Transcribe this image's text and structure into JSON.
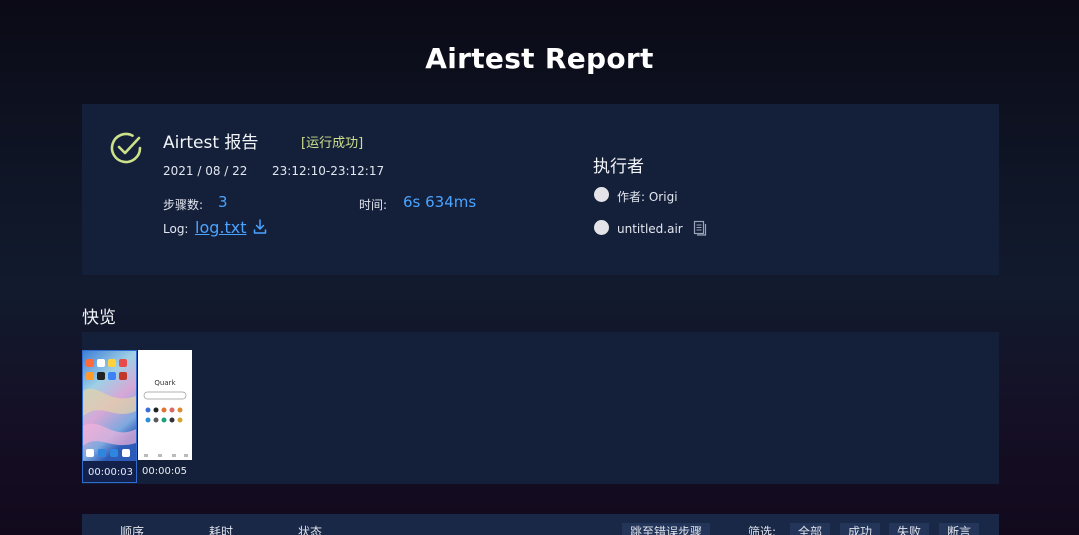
{
  "page_title": "Airtest Report",
  "summary": {
    "report_name": "Airtest 报告",
    "status": "[运行成功]",
    "date": "2021 / 08 / 22",
    "time_range": "23:12:10-23:12:17",
    "steps_label": "步骤数:",
    "steps_value": "3",
    "duration_label": "时间:",
    "duration_value": "6s 634ms",
    "log_label": "Log:",
    "log_file": "log.txt",
    "status_color": "#cde08a",
    "accent_color": "#4aa3ff"
  },
  "executor": {
    "title": "执行者",
    "author": "作者:  Origi",
    "script": "untitled.air"
  },
  "gallery": {
    "title": "快览",
    "thumbnails": [
      {
        "time": "00:00:03",
        "app": "home-screen"
      },
      {
        "time": "00:00:05",
        "app": "Quark"
      }
    ]
  },
  "steps_table": {
    "col_order": "顺序",
    "col_duration": "耗时",
    "col_status": "状态",
    "jump_error": "跳至错误步骤",
    "filter_label": "筛选:",
    "filter_all": "全部",
    "filter_success": "成功",
    "filter_fail": "失败",
    "filter_assert": "断言"
  }
}
